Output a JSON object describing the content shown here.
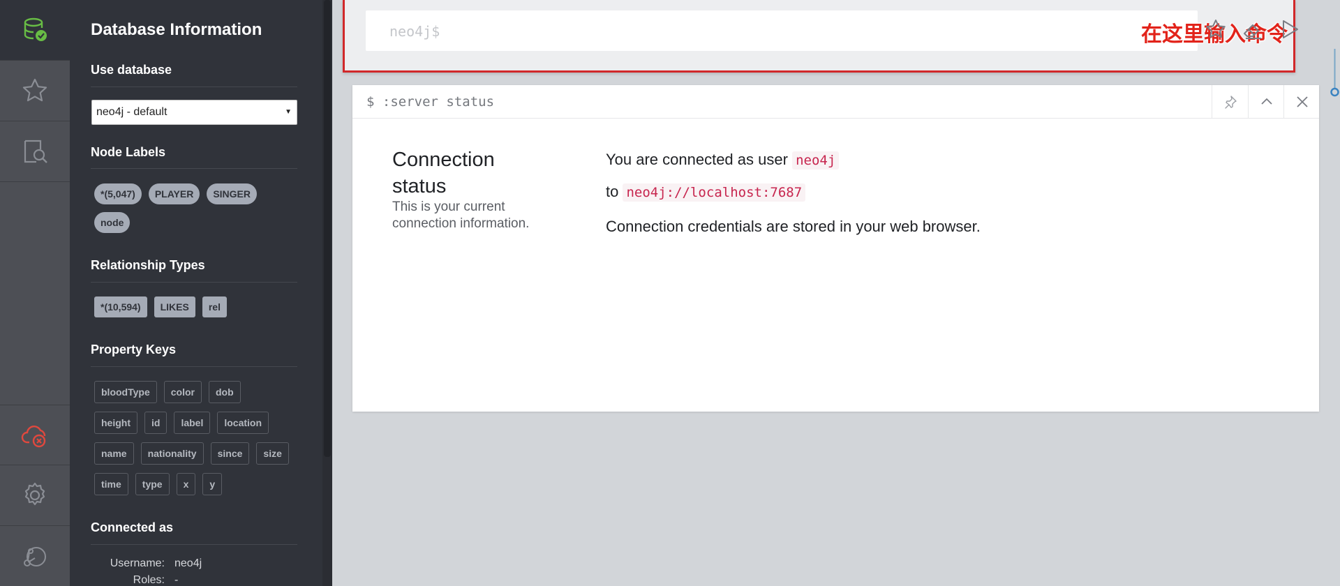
{
  "rail": {
    "items": [
      {
        "name": "database-icon",
        "active": true
      },
      {
        "name": "star-icon"
      },
      {
        "name": "search-document-icon"
      },
      {
        "name": "disconnected-cloud-icon",
        "color": "#e0483e"
      },
      {
        "name": "gear-icon"
      },
      {
        "name": "neo4j-logo-icon"
      }
    ]
  },
  "drawer": {
    "title": "Database Information",
    "use_database": {
      "heading": "Use database",
      "selected": "neo4j - default"
    },
    "node_labels": {
      "heading": "Node Labels",
      "chips": [
        "*(5,047)",
        "PLAYER",
        "SINGER",
        "node"
      ]
    },
    "relationship_types": {
      "heading": "Relationship Types",
      "chips": [
        "*(10,594)",
        "LIKES",
        "rel"
      ]
    },
    "property_keys": {
      "heading": "Property Keys",
      "chips": [
        "bloodType",
        "color",
        "dob",
        "height",
        "id",
        "label",
        "location",
        "name",
        "nationality",
        "since",
        "size",
        "time",
        "type",
        "x",
        "y"
      ]
    },
    "connected_as": {
      "heading": "Connected as",
      "username_label": "Username:",
      "username": "neo4j",
      "roles_label": "Roles:",
      "roles": "-"
    }
  },
  "editor": {
    "placeholder": "neo4j$",
    "annotation": "在这里输入命令",
    "actions": [
      "star-icon",
      "eraser-icon",
      "play-icon"
    ]
  },
  "frame": {
    "command": "$ :server status",
    "title": "Connection status",
    "subtitle": "This is your current connection information.",
    "line1_prefix": "You are connected as user",
    "user": "neo4j",
    "line2_prefix": "to",
    "url": "neo4j://localhost:7687",
    "line3": "Connection credentials are stored in your web browser."
  },
  "colors": {
    "accent_green": "#68bd45",
    "error_red": "#e0483e",
    "annotation_red": "#d1282a"
  }
}
